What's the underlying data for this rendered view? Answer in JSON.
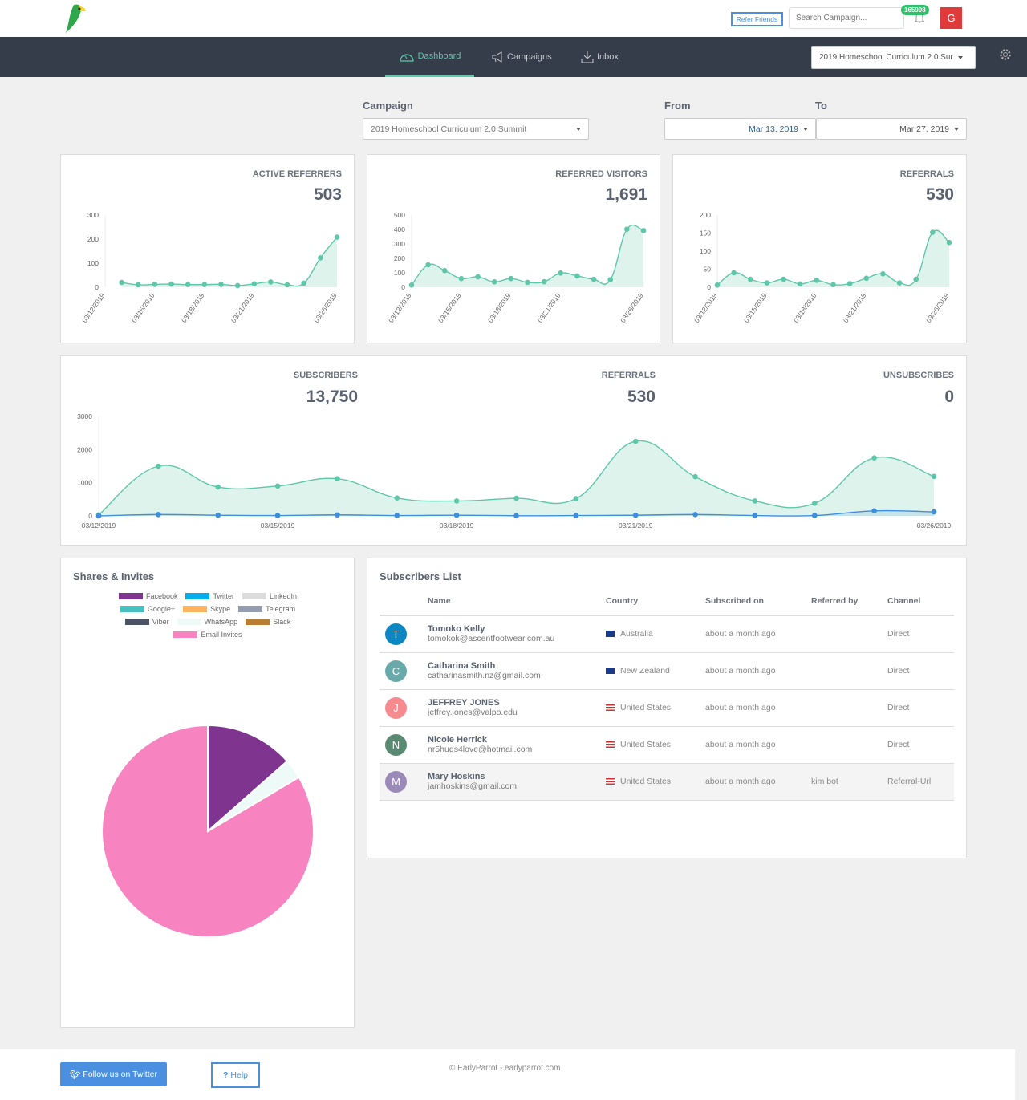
{
  "header": {
    "refer_label": "Refer Friends",
    "search_placeholder": "Search Campaign...",
    "notification_count": "165998",
    "user_initial": "G"
  },
  "nav": {
    "items": [
      {
        "label": "Dashboard",
        "icon": "dashboard-icon"
      },
      {
        "label": "Campaigns",
        "icon": "megaphone-icon"
      },
      {
        "label": "Inbox",
        "icon": "download-icon"
      }
    ],
    "campaign_select": "2019 Homeschool Curriculum 2.0 Sur"
  },
  "filters": {
    "campaign_label": "Campaign",
    "campaign_value": "2019 Homeschool Curriculum 2.0 Summit",
    "from_label": "From",
    "from_value": "Mar 13, 2019",
    "to_label": "To",
    "to_value": "Mar 27, 2019"
  },
  "colors": {
    "accent": "#5ec7a9",
    "fill": "#dff3ed",
    "blue": "#3d8fdc",
    "nav": "#353c4a"
  },
  "chart_data": [
    {
      "type": "line",
      "title": "ACTIVE REFERRERS",
      "total": "503",
      "x": [
        "03/13/2019",
        "03/14/2019",
        "03/15/2019",
        "03/16/2019",
        "03/17/2019",
        "03/18/2019",
        "03/19/2019",
        "03/20/2019",
        "03/21/2019",
        "03/22/2019",
        "03/23/2019",
        "03/24/2019",
        "03/25/2019",
        "03/26/2019"
      ],
      "values": [
        20,
        10,
        12,
        13,
        11,
        11,
        12,
        7,
        14,
        22,
        10,
        17,
        122,
        208
      ],
      "ylim": [
        0,
        300
      ],
      "yticks": [
        "300",
        "200",
        "100",
        "0"
      ],
      "xticks": [
        "03/12/2019",
        "03/15/2019",
        "03/18/2019",
        "03/21/2019",
        "03/26/2019"
      ]
    },
    {
      "type": "line",
      "title": "REFERRED VISITORS",
      "total": "1,691",
      "x": [
        "03/12/2019",
        "03/13/2019",
        "03/14/2019",
        "03/15/2019",
        "03/16/2019",
        "03/17/2019",
        "03/18/2019",
        "03/19/2019",
        "03/20/2019",
        "03/21/2019",
        "03/22/2019",
        "03/23/2019",
        "03/24/2019",
        "03/25/2019",
        "03/26/2019"
      ],
      "values": [
        15,
        155,
        115,
        60,
        72,
        37,
        60,
        34,
        38,
        98,
        78,
        55,
        52,
        402,
        392
      ],
      "ylim": [
        0,
        500
      ],
      "yticks": [
        "500",
        "400",
        "300",
        "200",
        "100",
        "0"
      ],
      "xticks": [
        "03/12/2019",
        "03/15/2019",
        "03/18/2019",
        "03/21/2019",
        "03/26/2019"
      ]
    },
    {
      "type": "line",
      "title": "REFERRALS",
      "total": "530",
      "x": [
        "03/12/2019",
        "03/13/2019",
        "03/14/2019",
        "03/15/2019",
        "03/16/2019",
        "03/17/2019",
        "03/18/2019",
        "03/19/2019",
        "03/20/2019",
        "03/21/2019",
        "03/22/2019",
        "03/23/2019",
        "03/24/2019",
        "03/25/2019",
        "03/26/2019"
      ],
      "values": [
        6,
        40,
        22,
        12,
        22,
        9,
        19,
        7,
        10,
        25,
        37,
        12,
        22,
        152,
        124
      ],
      "ylim": [
        0,
        200
      ],
      "yticks": [
        "200",
        "150",
        "100",
        "50",
        "0"
      ],
      "xticks": [
        "03/12/2019",
        "03/15/2019",
        "03/18/2019",
        "03/21/2019",
        "03/26/2019"
      ]
    },
    {
      "type": "area",
      "stats": [
        {
          "label": "SUBSCRIBERS",
          "value": "13,750"
        },
        {
          "label": "REFERRALS",
          "value": "530"
        },
        {
          "label": "UNSUBSCRIBES",
          "value": "0"
        }
      ],
      "x": [
        "03/12/2019",
        "03/13/2019",
        "03/14/2019",
        "03/15/2019",
        "03/16/2019",
        "03/17/2019",
        "03/18/2019",
        "03/19/2019",
        "03/20/2019",
        "03/21/2019",
        "03/22/2019",
        "03/23/2019",
        "03/24/2019",
        "03/25/2019",
        "03/26/2019"
      ],
      "series": [
        {
          "color": "#5ec7a9",
          "values": [
            30,
            1500,
            870,
            900,
            1120,
            540,
            450,
            530,
            520,
            2250,
            1180,
            450,
            380,
            1750,
            1190
          ]
        },
        {
          "color": "#3d8fdc",
          "values": [
            0,
            40,
            20,
            10,
            30,
            10,
            20,
            5,
            10,
            20,
            40,
            10,
            10,
            150,
            120
          ]
        }
      ],
      "ylim": [
        0,
        3000
      ],
      "yticks": [
        "3000",
        "2000",
        "1000",
        "0"
      ],
      "xticks": [
        "03/12/2019",
        "03/15/2019",
        "03/18/2019",
        "03/21/2019",
        "03/26/2019"
      ]
    },
    {
      "type": "pie",
      "title": "Shares & Invites",
      "legend": [
        {
          "name": "Facebook",
          "color": "#7f3590"
        },
        {
          "name": "Twitter",
          "color": "#00aef0"
        },
        {
          "name": "LinkedIn",
          "color": "#dcdcdc"
        },
        {
          "name": "Google+",
          "color": "#47c1bf"
        },
        {
          "name": "Skype",
          "color": "#ffb35e"
        },
        {
          "name": "Telegram",
          "color": "#939daf"
        },
        {
          "name": "Viber",
          "color": "#4b5264"
        },
        {
          "name": "WhatsApp",
          "color": "#eefaf8"
        },
        {
          "name": "Slack",
          "color": "#b67f33"
        },
        {
          "name": "Email Invites",
          "color": "#f784c1"
        }
      ],
      "slices": [
        {
          "name": "Facebook",
          "value": 13.5
        },
        {
          "name": "WhatsApp",
          "value": 3
        },
        {
          "name": "Email Invites",
          "value": 83.5
        }
      ]
    }
  ],
  "subscribers": {
    "title": "Subscribers List",
    "columns": [
      "Name",
      "Country",
      "Subscribed on",
      "Referred by",
      "Channel"
    ],
    "rows": [
      {
        "initial": "T",
        "color": "#0d87c3",
        "name": "Tomoko Kelly",
        "email": "tomokok@ascentfootwear.com.au",
        "country": "Australia",
        "flag": "au",
        "subscribed": "about a month ago",
        "referred_by": "",
        "channel": "Direct"
      },
      {
        "initial": "C",
        "color": "#6aa9a9",
        "name": "Catharina Smith",
        "email": "catharinasmith.nz@gmail.com",
        "country": "New Zealand",
        "flag": "nz",
        "subscribed": "about a month ago",
        "referred_by": "",
        "channel": "Direct"
      },
      {
        "initial": "J",
        "color": "#f58a8f",
        "name": "JEFFREY JONES",
        "email": "jeffrey.jones@valpo.edu",
        "country": "United States",
        "flag": "us",
        "subscribed": "about a month ago",
        "referred_by": "",
        "channel": "Direct"
      },
      {
        "initial": "N",
        "color": "#5a8a72",
        "name": "Nicole Herrick",
        "email": "nr5hugs4love@hotmail.com",
        "country": "United States",
        "flag": "us",
        "subscribed": "about a month ago",
        "referred_by": "",
        "channel": "Direct"
      },
      {
        "initial": "M",
        "color": "#9b8ab8",
        "name": "Mary Hoskins",
        "email": "jamhoskins@gmail.com",
        "country": "United States",
        "flag": "us",
        "subscribed": "about a month ago",
        "referred_by": "kim bot",
        "channel": "Referral-Url"
      }
    ]
  },
  "footer": {
    "twitter_label": "Follow us on Twitter",
    "help_label": "Help",
    "copyright": "© EarlyParrot - earlyparrot.com"
  }
}
